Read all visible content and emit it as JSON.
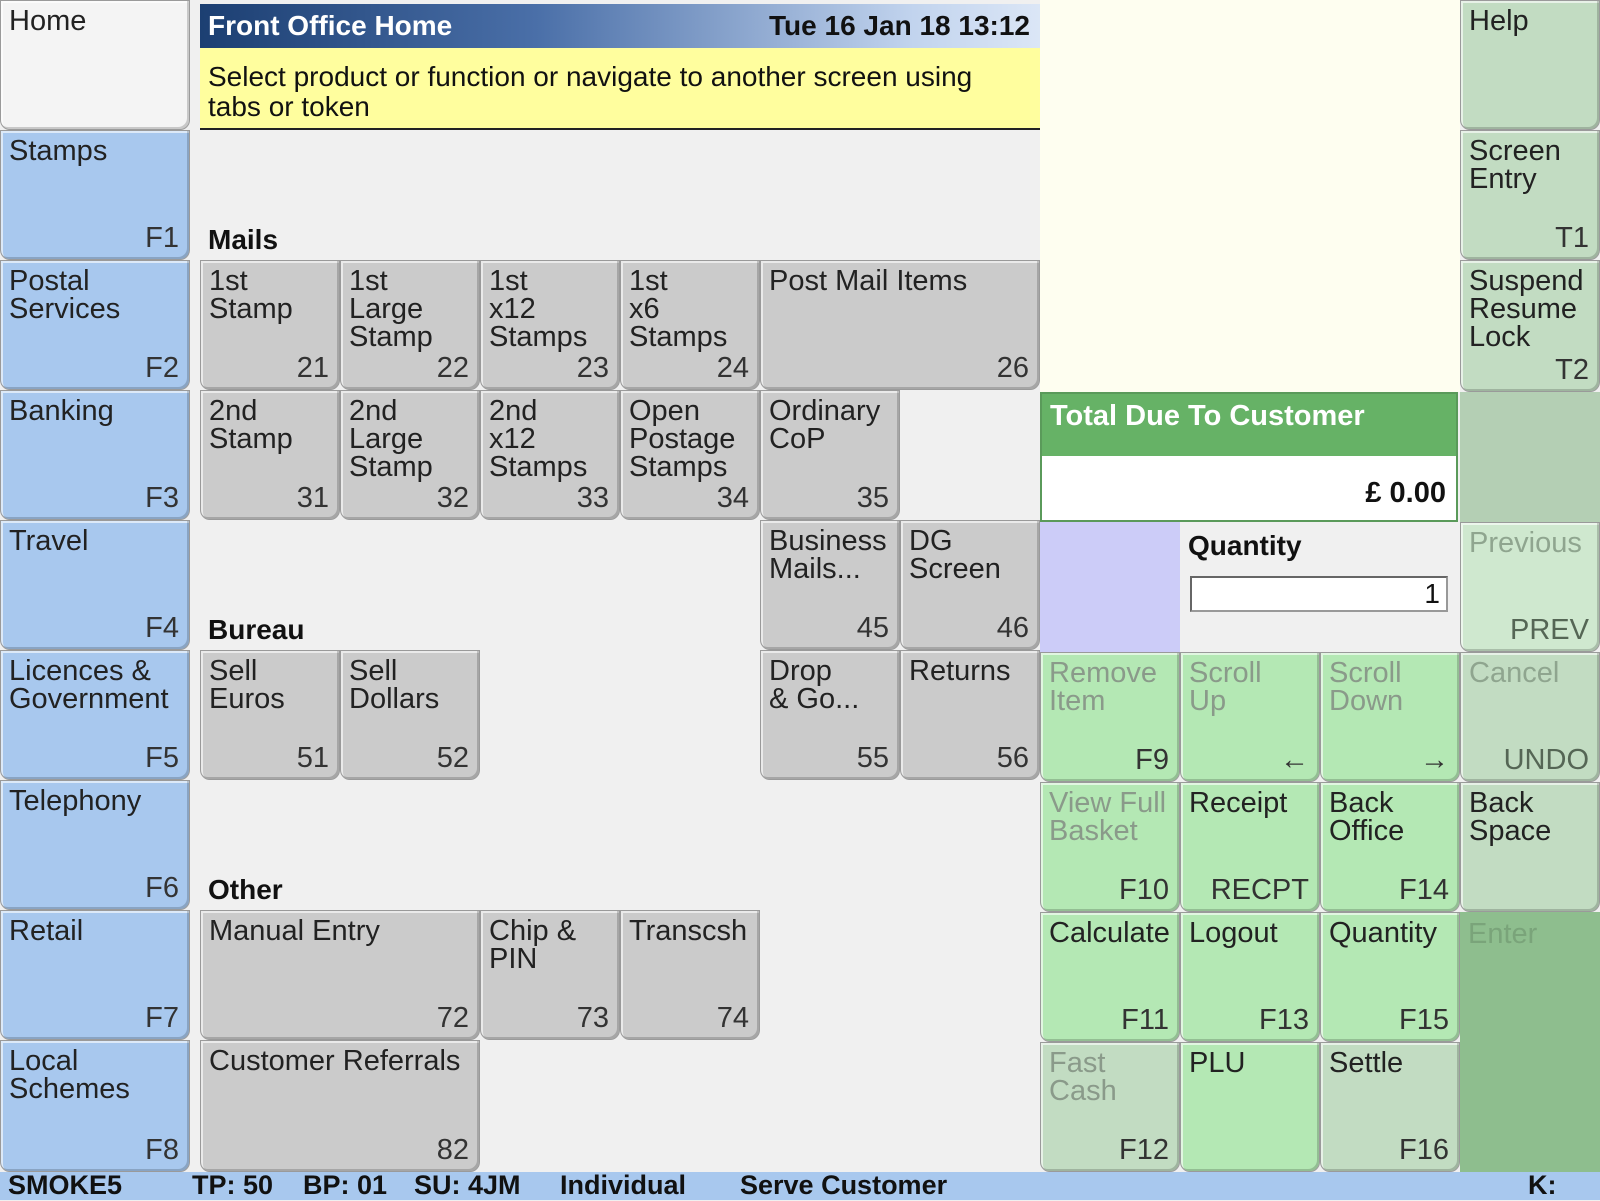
{
  "titlebar": {
    "title": "Front Office Home",
    "datetime": "Tue 16 Jan 18 13:12"
  },
  "prompt": "Select product or function or navigate to another screen using tabs or token",
  "left_nav": [
    {
      "label": "Home",
      "key": ""
    },
    {
      "label": "Stamps",
      "key": "F1"
    },
    {
      "label": "Postal\nServices",
      "key": "F2"
    },
    {
      "label": "Banking",
      "key": "F3"
    },
    {
      "label": "Travel",
      "key": "F4"
    },
    {
      "label": "Licences &\nGovernment",
      "key": "F5"
    },
    {
      "label": "Telephony",
      "key": "F6"
    },
    {
      "label": "Retail",
      "key": "F7"
    },
    {
      "label": "Local\nSchemes",
      "key": "F8"
    }
  ],
  "sections": {
    "mails": "Mails",
    "bureau": "Bureau",
    "other": "Other"
  },
  "products": {
    "p21": {
      "label": "1st\nStamp",
      "key": "21"
    },
    "p22": {
      "label": "1st\nLarge\nStamp",
      "key": "22"
    },
    "p23": {
      "label": "1st\nx12\nStamps",
      "key": "23"
    },
    "p24": {
      "label": "1st\nx6\nStamps",
      "key": "24"
    },
    "p26": {
      "label": "Post Mail Items",
      "key": "26"
    },
    "p31": {
      "label": "2nd\nStamp",
      "key": "31"
    },
    "p32": {
      "label": "2nd\nLarge\nStamp",
      "key": "32"
    },
    "p33": {
      "label": "2nd\nx12\nStamps",
      "key": "33"
    },
    "p34": {
      "label": "Open\nPostage\nStamps",
      "key": "34"
    },
    "p35": {
      "label": "Ordinary\nCoP",
      "key": "35"
    },
    "p45": {
      "label": "Business\nMails...",
      "key": "45"
    },
    "p46": {
      "label": "DG\nScreen",
      "key": "46"
    },
    "p51": {
      "label": "Sell\nEuros",
      "key": "51"
    },
    "p52": {
      "label": "Sell\nDollars",
      "key": "52"
    },
    "p55": {
      "label": "Drop\n& Go...",
      "key": "55"
    },
    "p56": {
      "label": "Returns",
      "key": "56"
    },
    "p72": {
      "label": "Manual Entry",
      "key": "72"
    },
    "p73": {
      "label": "Chip &\nPIN",
      "key": "73"
    },
    "p74": {
      "label": "Transcsh",
      "key": "74"
    },
    "p82": {
      "label": "Customer Referrals",
      "key": "82"
    }
  },
  "right_nav": {
    "help": {
      "label": "Help",
      "key": ""
    },
    "screen_entry": {
      "label": "Screen\nEntry",
      "key": "T1"
    },
    "suspend": {
      "label": "Suspend\nResume\nLock",
      "key": "T2"
    },
    "previous": {
      "label": "Previous",
      "key": "PREV"
    },
    "cancel": {
      "label": "Cancel",
      "key": "UNDO"
    },
    "backspace": {
      "label": "Back\nSpace",
      "key": ""
    },
    "enter": {
      "label": "Enter"
    }
  },
  "total": {
    "label": "Total Due To Customer",
    "amount": "£ 0.00"
  },
  "quantity": {
    "label": "Quantity",
    "value": "1"
  },
  "function_keys": {
    "remove_item": {
      "label": "Remove\nItem",
      "key": "F9"
    },
    "scroll_up": {
      "label": "Scroll\nUp",
      "key": "←"
    },
    "scroll_down": {
      "label": "Scroll\nDown",
      "key": "→"
    },
    "view_basket": {
      "label": "View Full\nBasket",
      "key": "F10"
    },
    "receipt": {
      "label": "Receipt",
      "key": "RECPT"
    },
    "back_office": {
      "label": "Back\nOffice",
      "key": "F14"
    },
    "calculate": {
      "label": "Calculate",
      "key": "F11"
    },
    "logout": {
      "label": "Logout",
      "key": "F13"
    },
    "quantity": {
      "label": "Quantity",
      "key": "F15"
    },
    "fast_cash": {
      "label": "Fast\nCash",
      "key": "F12"
    },
    "plu": {
      "label": "PLU",
      "key": ""
    },
    "settle": {
      "label": "Settle",
      "key": "F16"
    }
  },
  "status": {
    "user": "SMOKE5",
    "tp": "TP: 50",
    "bp": "BP: 01",
    "su": "SU: 4JM",
    "mode": "Individual",
    "action": "Serve Customer",
    "k": "K:"
  }
}
